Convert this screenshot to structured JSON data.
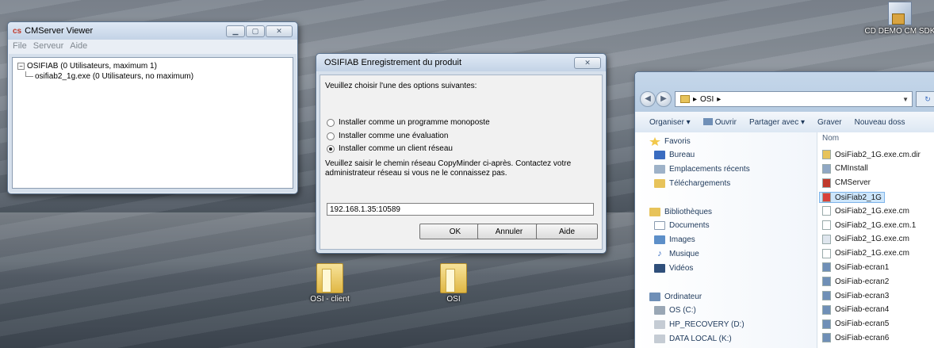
{
  "desktop": {
    "icons": [
      {
        "label": "OSI - client"
      },
      {
        "label": "OSI"
      },
      {
        "label": "CD DEMO CM SDK"
      }
    ]
  },
  "cmserver": {
    "title": "CMServer Viewer",
    "menu": [
      "File",
      "Serveur",
      "Aide"
    ],
    "tree": {
      "root": "OSIFIAB (0 Utilisateurs, maximum 1)",
      "child": "osifiab2_1g.exe (0 Utilisateurs, no maximum)"
    }
  },
  "dialog": {
    "title": "OSIFIAB Enregistrement du produit",
    "prompt": "Veuillez choisir l'une des options suivantes:",
    "options": [
      {
        "label": "Installer comme un programme monoposte",
        "selected": false
      },
      {
        "label": "Installer comme une évaluation",
        "selected": false
      },
      {
        "label": "Installer comme un client réseau",
        "selected": true
      }
    ],
    "note": "Veuillez saisir le chemin réseau CopyMinder ci-après. Contactez votre administrateur réseau si vous ne le connaissez pas.",
    "input_value": "192.168.1.35:10589",
    "buttons": {
      "ok": "OK",
      "cancel": "Annuler",
      "help": "Aide"
    }
  },
  "explorer": {
    "path": "OSI",
    "commands": [
      "Organiser",
      "Ouvrir",
      "Partager avec",
      "Graver",
      "Nouveau doss"
    ],
    "nav": {
      "favorites_header": "Favoris",
      "favorites": [
        "Bureau",
        "Emplacements récents",
        "Téléchargements"
      ],
      "libraries_header": "Bibliothèques",
      "libraries": [
        "Documents",
        "Images",
        "Musique",
        "Vidéos"
      ],
      "computer_header": "Ordinateur",
      "drives": [
        "OS (C:)",
        "HP_RECOVERY (D:)",
        "DATA LOCAL (K:)"
      ]
    },
    "column_header": "Nom",
    "files": [
      "OsiFiab2_1G.exe.cm.dir",
      "CMInstall",
      "CMServer",
      "OsiFiab2_1G",
      "OsiFiab2_1G.exe.cm",
      "OsiFiab2_1G.exe.cm.1",
      "OsiFiab2_1G.exe.cm",
      "OsiFiab2_1G.exe.cm",
      "OsiFiab-ecran1",
      "OsiFiab-ecran2",
      "OsiFiab-ecran3",
      "OsiFiab-ecran4",
      "OsiFiab-ecran5",
      "OsiFiab-ecran6"
    ],
    "selected_file_index": 3
  },
  "colors": {
    "accent": "#3a6cc0",
    "selection": "#cde6fb"
  }
}
